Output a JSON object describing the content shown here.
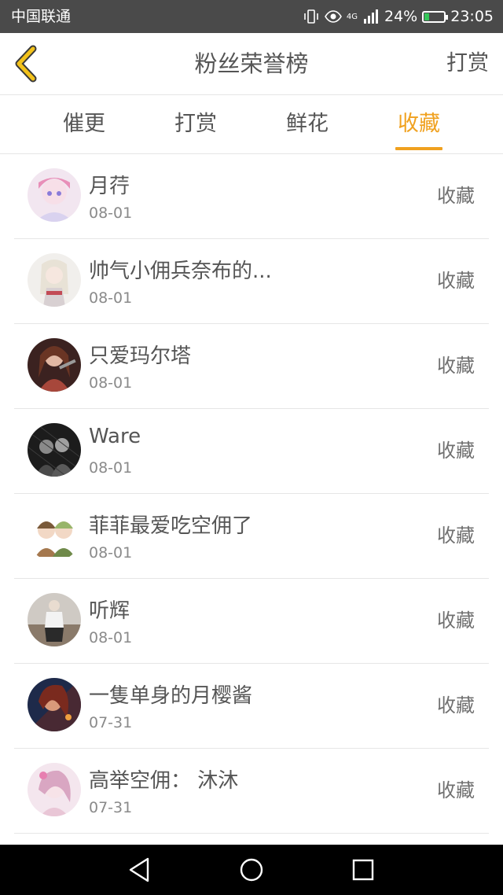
{
  "status_bar": {
    "carrier": "中国联通",
    "network": "4G",
    "battery": "24%",
    "battery_level": 0.24,
    "time": "23:05"
  },
  "header": {
    "title": "粉丝荣誉榜",
    "right_action": "打赏",
    "back_icon": "chevron-left-icon",
    "accent_color": "#f0a11f"
  },
  "tabs": [
    {
      "label": "催更",
      "active": false
    },
    {
      "label": "打赏",
      "active": false
    },
    {
      "label": "鲜花",
      "active": false
    },
    {
      "label": "收藏",
      "active": true
    }
  ],
  "fans": [
    {
      "name": "月荇",
      "date": "08-01",
      "action": "收藏"
    },
    {
      "name": "帅气小佣兵奈布的...",
      "date": "08-01",
      "action": "收藏"
    },
    {
      "name": "只爱玛尔塔",
      "date": "08-01",
      "action": "收藏"
    },
    {
      "name": "Ware",
      "date": "08-01",
      "action": "收藏"
    },
    {
      "name": "菲菲最爱吃空佣了",
      "date": "08-01",
      "action": "收藏"
    },
    {
      "name": "听辉",
      "date": "08-01",
      "action": "收藏"
    },
    {
      "name": "一隻单身的月樱酱",
      "date": "07-31",
      "action": "收藏"
    },
    {
      "name": "高举空佣： 沐沐",
      "date": "07-31",
      "action": "收藏"
    }
  ],
  "nav": {
    "back": "triangle-back-icon",
    "home": "circle-home-icon",
    "recent": "square-recent-icon"
  }
}
